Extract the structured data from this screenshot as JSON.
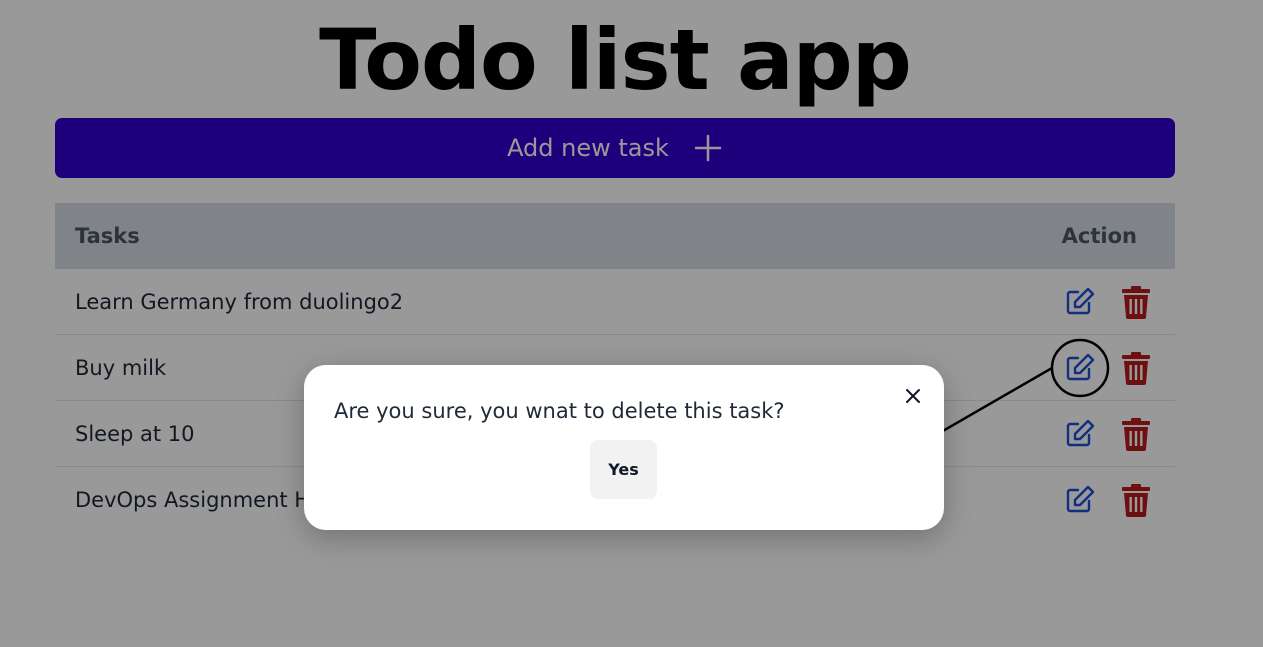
{
  "app": {
    "title": "Todo list app"
  },
  "add_button": {
    "label": "Add new task",
    "icon": "plus-icon"
  },
  "table": {
    "headers": {
      "tasks": "Tasks",
      "action": "Action"
    },
    "rows": [
      {
        "task": "Learn Germany from duolingo2"
      },
      {
        "task": "Buy milk"
      },
      {
        "task": "Sleep at 10"
      },
      {
        "task": "DevOps Assignment Ha"
      }
    ],
    "action_icons": [
      "edit-icon",
      "trash-icon"
    ]
  },
  "modal": {
    "message": "Are you sure, you wnat to delete this task?",
    "confirm_label": "Yes",
    "close_icon": "close-icon"
  },
  "colors": {
    "primary": "#3400cf",
    "edit_icon": "#1d4ed8",
    "delete_icon": "#b91c1c",
    "table_header_bg": "#d6dce4"
  }
}
